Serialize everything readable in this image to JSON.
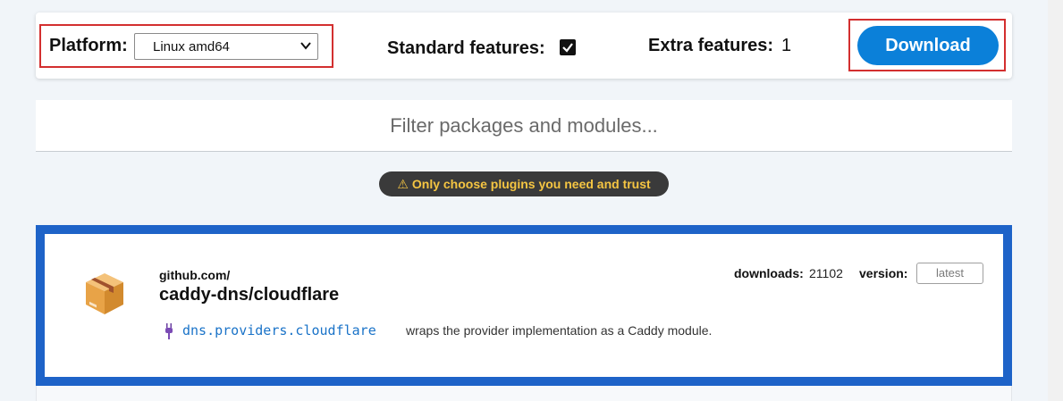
{
  "toolbar": {
    "platform_label": "Platform:",
    "platform_value": "Linux amd64",
    "standard_features_label": "Standard features:",
    "standard_features_checked": true,
    "extra_features_label": "Extra features:",
    "extra_features_value": "1",
    "download_label": "Download"
  },
  "filter": {
    "placeholder": "Filter packages and modules..."
  },
  "warning": {
    "icon": "warning-icon",
    "text": "Only choose plugins you need and trust"
  },
  "package": {
    "icon": "package-box-icon",
    "host": "github.com/",
    "name": "caddy-dns/cloudflare",
    "downloads_label": "downloads:",
    "downloads_value": "21102",
    "version_label": "version:",
    "version_placeholder": "latest",
    "module": {
      "icon": "plug-icon",
      "name": "dns.providers.cloudflare",
      "description": "wraps the provider implementation as a Caddy module."
    }
  },
  "colors": {
    "accent": "#0b80d9",
    "selected_border": "#1e63c8",
    "highlight": "#d32f2f",
    "warning_text": "#f5c542",
    "module_link": "#1a73c8"
  }
}
